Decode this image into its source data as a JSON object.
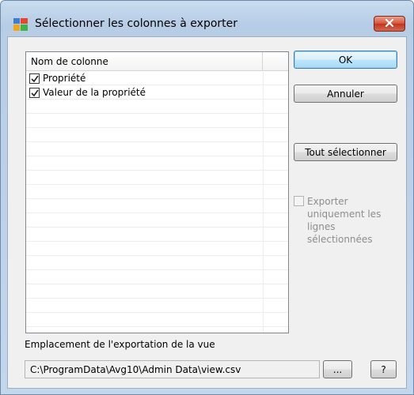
{
  "window": {
    "title": "Sélectionner les colonnes à exporter",
    "icon": "avg-logo-icon",
    "close_icon": "close-icon"
  },
  "column_list": {
    "header": "Nom de colonne",
    "items": [
      {
        "label": "Propriété",
        "checked": true
      },
      {
        "label": "Valeur de la propriété",
        "checked": true
      }
    ]
  },
  "buttons": {
    "ok": "OK",
    "cancel": "Annuler",
    "select_all": "Tout sélectionner",
    "browse": "...",
    "help": "?"
  },
  "export_only_selected": {
    "label": "Exporter uniquement les lignes sélectionnées",
    "checked": false,
    "enabled": false
  },
  "export_location": {
    "label": "Emplacement de l'exportation de la vue",
    "path": "C:\\ProgramData\\Avg10\\Admin Data\\view.csv"
  },
  "colors": {
    "accent_border": "#3c7fb1",
    "close_red": "#c2341e"
  }
}
